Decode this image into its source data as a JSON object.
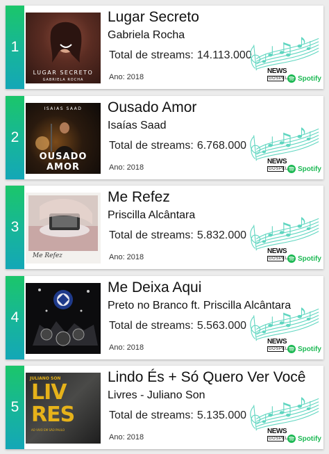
{
  "labels": {
    "streams_label": "Total de streams:",
    "year_label": "Ano:",
    "news_line1": "NEWS",
    "news_line2": "GOSPEL",
    "spotify": "Spotify"
  },
  "colors": {
    "rank_gradient_top": "#1bc66a",
    "rank_gradient_bottom": "#14a7b7",
    "notes_color": "#5fd6c0",
    "spotify_green": "#1db954"
  },
  "icons": [
    "music-notes-icon",
    "spotify-icon",
    "news-gospel-logo"
  ],
  "songs": [
    {
      "rank": "1",
      "title": "Lugar Secreto",
      "artist": "Gabriela Rocha",
      "streams": "14.113.000",
      "year": "2018",
      "cover_title": "LUGAR SECRETO",
      "cover_artist": "GABRIELA ROCHA"
    },
    {
      "rank": "2",
      "title": "Ousado Amor",
      "artist": "Isaías Saad",
      "streams": "6.768.000",
      "year": "2018",
      "cover_top": "ISAIAS SAAD",
      "cover_l1": "OUSADO",
      "cover_l2": "AMOR"
    },
    {
      "rank": "3",
      "title": "Me Refez",
      "artist": "Priscilla Alcântara",
      "streams": "5.832.000",
      "year": "2018",
      "cover_script": "Me Refez"
    },
    {
      "rank": "4",
      "title": "Me Deixa Aqui",
      "artist": "Preto no Branco ft. Priscilla Alcântara",
      "streams": "5.563.000",
      "year": "2018"
    },
    {
      "rank": "5",
      "title": "Lindo És + Só Quero Ver Você",
      "artist": "Livres - Juliano Son",
      "streams": "5.135.000",
      "year": "2018",
      "cover_top": "JULIANO SON",
      "cover_l1": "LIV",
      "cover_l2": "RES",
      "cover_sub": "AO VIVO EM SÃO PAULO"
    }
  ]
}
